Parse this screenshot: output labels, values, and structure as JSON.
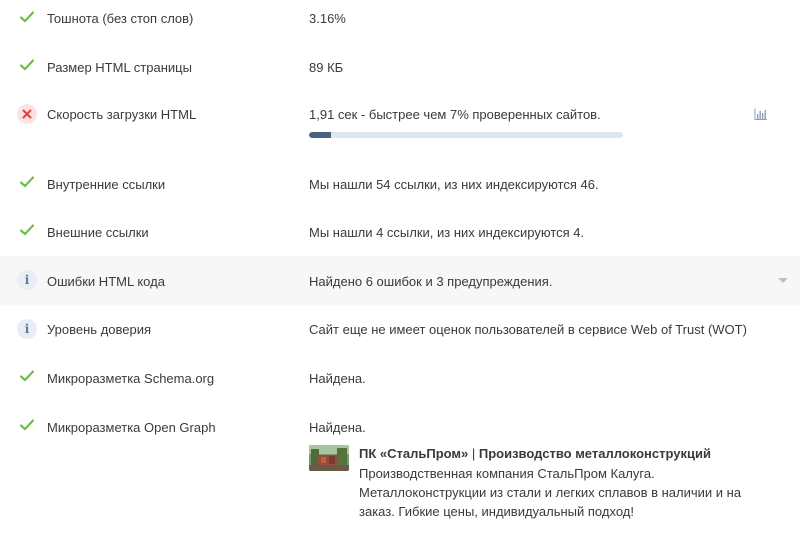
{
  "rows": [
    {
      "name": "Тошнота (без стоп слов)",
      "value": "3.16%",
      "status": "ok"
    },
    {
      "name": "Размер HTML страницы",
      "value": "89 КБ",
      "status": "ok"
    },
    {
      "name": "Скорость загрузки HTML",
      "value": "1,91 сек - быстрее чем 7% проверенных сайтов.",
      "status": "error",
      "progress_percent": 7
    },
    {
      "name": "Внутренние ссылки",
      "value": "Мы нашли 54 ссылки, из них индексируются 46.",
      "status": "ok"
    },
    {
      "name": "Внешние ссылки",
      "value": "Мы нашли 4 ссылки, из них индексируются 4.",
      "status": "ok"
    },
    {
      "name": "Ошибки HTML кода",
      "value": "Найдено 6 ошибок и 3 предупреждения.",
      "status": "info"
    },
    {
      "name": "Уровень доверия",
      "value": "Сайт еще не имеет оценок пользователей в сервисе Web of Trust (WOT)",
      "status": "info"
    },
    {
      "name": "Микроразметка Schema.org",
      "value": "Найдена.",
      "status": "ok"
    },
    {
      "name": "Микроразметка Open Graph",
      "value": "Найдена.",
      "status": "ok"
    }
  ],
  "og_card": {
    "title_site": "ПК «СтальПром»",
    "title_separator": " | ",
    "title_page": "Производство металлоконструкций",
    "description": "Производственная компания СтальПром Калуга. Металлоконструкции из стали и легких сплавов в наличии и на заказ. Гибкие цены, индивидуальный подход!"
  },
  "icons": {
    "ok": "check-icon",
    "error": "cross-icon",
    "info": "info-icon",
    "chart": "bar-chart-icon",
    "expand": "chevron-down-icon"
  },
  "colors": {
    "ok": "#6cc04a",
    "error": "#e0413a",
    "info": "#5a7ba6",
    "progress": "#4a6280"
  }
}
